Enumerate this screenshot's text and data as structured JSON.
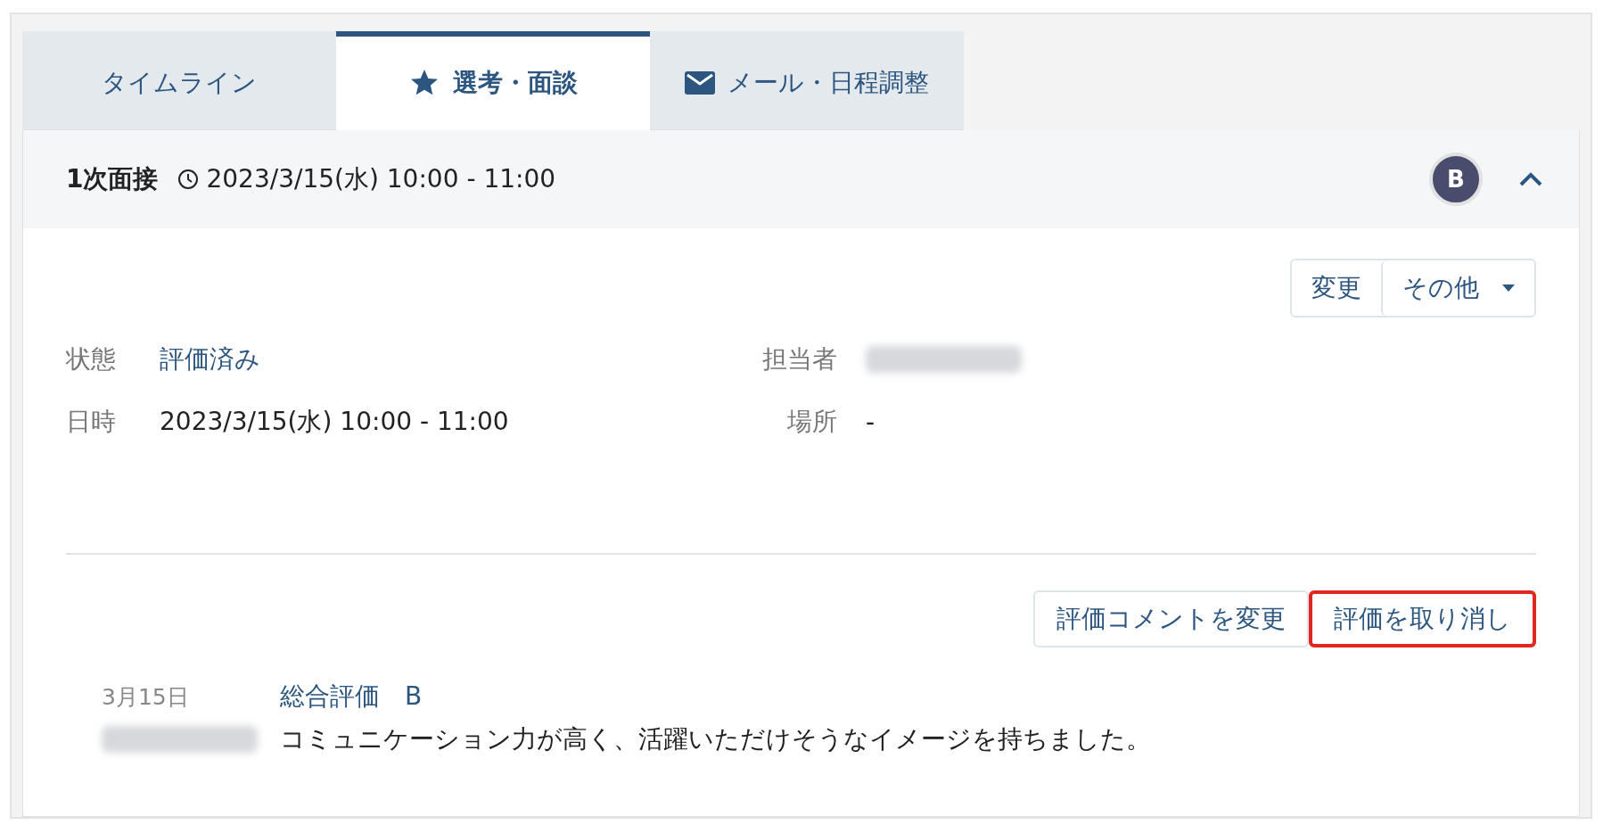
{
  "tabs": [
    {
      "label": "タイムライン",
      "selected": false
    },
    {
      "label": "選考・面談",
      "selected": true
    },
    {
      "label": "メール・日程調整",
      "selected": false
    }
  ],
  "header": {
    "title": "1次面接",
    "datetime": "2023/3/15(水) 10:00 - 11:00",
    "avatar_letter": "B",
    "expanded": true
  },
  "actions": [
    "変更",
    "その他"
  ],
  "fields": [
    {
      "label": "状態",
      "value": "評価済み",
      "kind": "link"
    },
    {
      "label": "担当者",
      "kind": "blurred"
    },
    {
      "label": "日時",
      "value": "2023/3/15(水) 10:00 - 11:00",
      "kind": "text"
    },
    {
      "label": "場所",
      "value": "-",
      "kind": "text"
    }
  ],
  "evaluation_buttons": [
    {
      "label": "評価コメントを変更",
      "highlighted": false
    },
    {
      "label": "評価を取り消し",
      "highlighted": true
    }
  ],
  "comment": {
    "date": "3月15日",
    "title": "総合評価　B",
    "text": "コミュニケーション力が高く、活躍いただけそうなイメージを持ちました。"
  }
}
